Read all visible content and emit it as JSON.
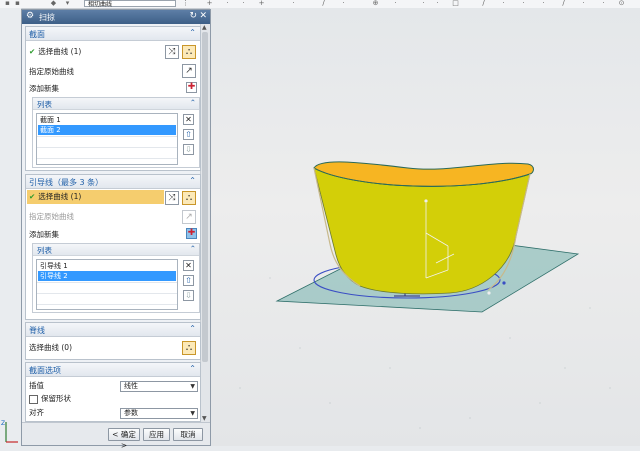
{
  "toolbar": {
    "filter_value": "相切曲线"
  },
  "dialog": {
    "title": "扫掠",
    "section_curves": {
      "label": "截面",
      "select_curve": "选择曲线 (1)",
      "specify_origin": "指定原始曲线",
      "add_new_set": "添加新集",
      "list": {
        "label": "列表",
        "items": [
          "截面 1",
          "截面 2"
        ]
      }
    },
    "guides": {
      "label": "引导线（最多 3 条）",
      "select_curve": "选择曲线 (1)",
      "specify_origin": "指定原始曲线",
      "add_new_set": "添加新集",
      "list": {
        "label": "列表",
        "items": [
          "引导线 1",
          "引导线 2"
        ]
      }
    },
    "spine": {
      "label": "脊线",
      "select_curve": "选择曲线 (0)"
    },
    "section_options": {
      "label": "截面选项",
      "interp_label": "插值",
      "interp_value": "线性",
      "preserve_shape": "保留形状",
      "align_label": "对齐",
      "align_value": "参数"
    },
    "buttons": {
      "ok": "< 确定 >",
      "apply": "应用",
      "cancel": "取消"
    }
  },
  "colors": {
    "accent": "#1f5fa8",
    "highlight": "#f5cd6e",
    "selection": "#3399ff",
    "surface": "#d3cf08",
    "surface_inner": "#f7b522",
    "plane": "#5aa7a0"
  }
}
